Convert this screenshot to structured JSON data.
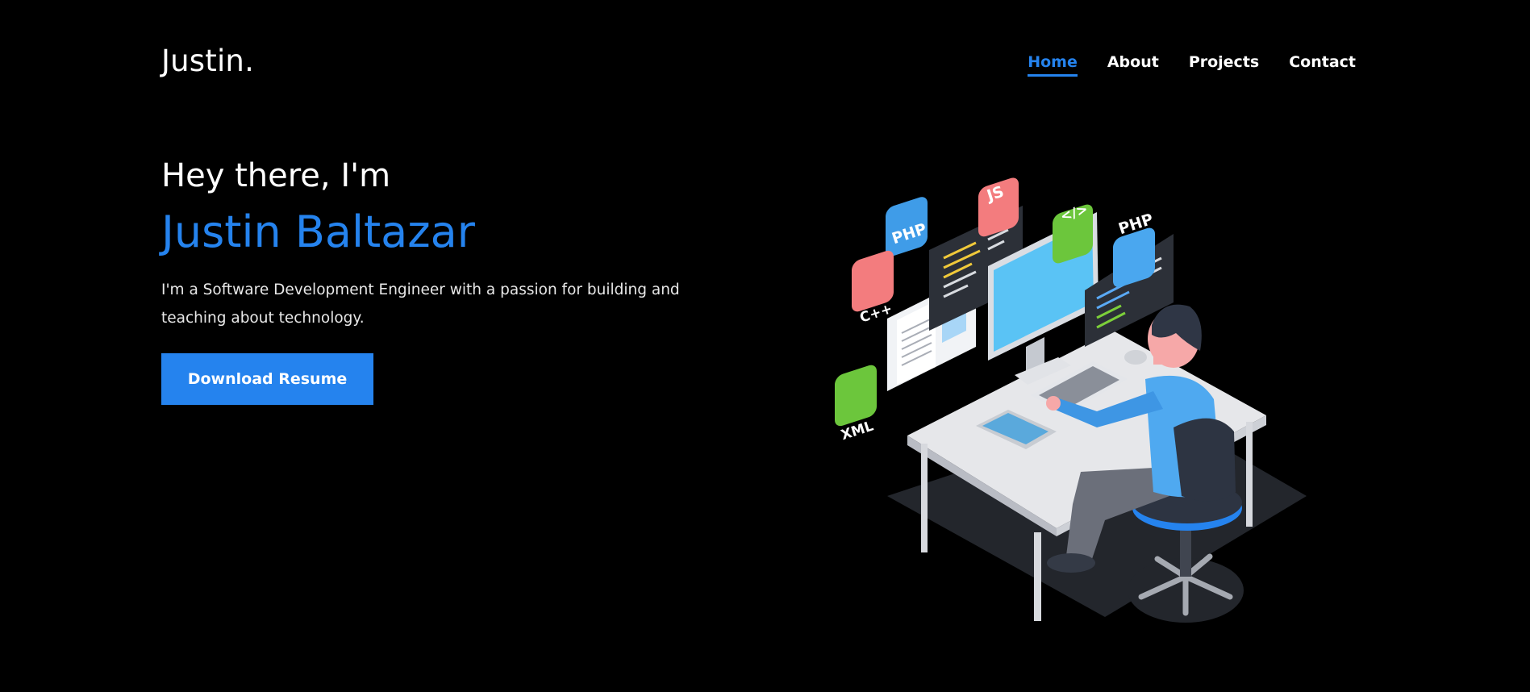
{
  "header": {
    "logo": "Justin.",
    "nav": [
      {
        "label": "Home",
        "active": true
      },
      {
        "label": "About",
        "active": false
      },
      {
        "label": "Projects",
        "active": false
      },
      {
        "label": "Contact",
        "active": false
      }
    ]
  },
  "hero": {
    "greeting": "Hey there, I'm",
    "name": "Justin Baltazar",
    "tagline": "I'm a Software Development Engineer with a passion for building and teaching about technology.",
    "button_label": "Download Resume"
  },
  "illustration": {
    "tags": [
      "PHP",
      "JS",
      "</>",
      "PHP",
      "C++",
      "XML"
    ]
  },
  "colors": {
    "accent": "#2583ee",
    "background": "#000000",
    "text": "#ffffff"
  }
}
